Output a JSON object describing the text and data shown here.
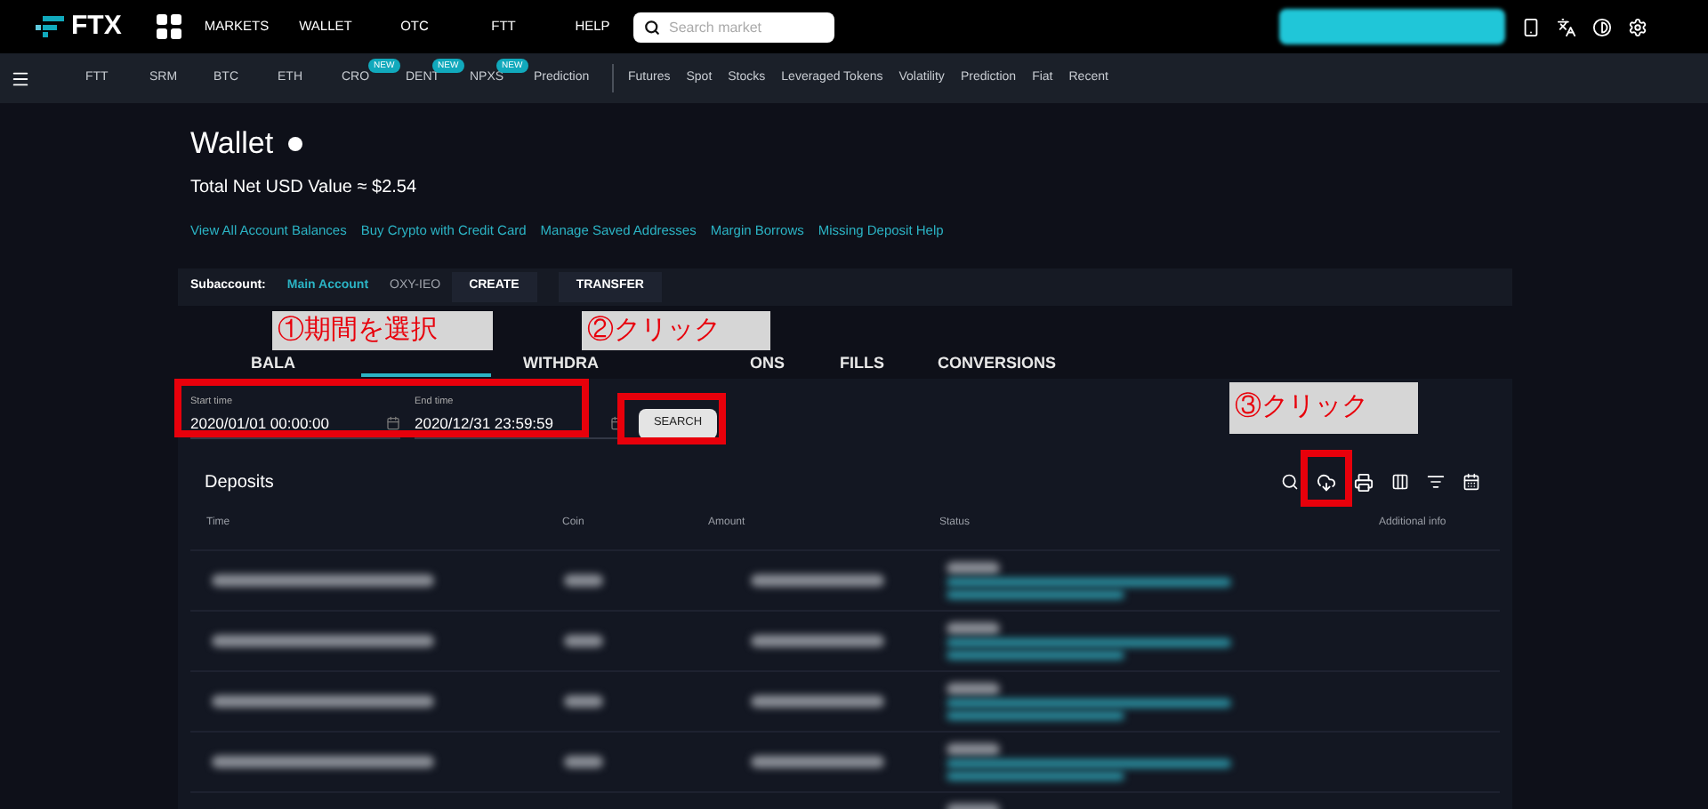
{
  "top_nav": {
    "logo": "FTX",
    "links": [
      "MARKETS",
      "WALLET",
      "OTC",
      "FTT",
      "HELP"
    ],
    "search": {
      "placeholder": "Search market"
    }
  },
  "sub_nav": {
    "groups": [
      [
        {
          "label": "FTT"
        },
        {
          "label": "SRM"
        },
        {
          "label": "BTC"
        },
        {
          "label": "ETH"
        },
        {
          "label": "CRO",
          "badge": "NEW"
        },
        {
          "label": "DENT",
          "badge": "NEW"
        },
        {
          "label": "NPXS",
          "badge": "NEW"
        },
        {
          "label": "Prediction"
        }
      ],
      [
        {
          "label": "Futures"
        },
        {
          "label": "Spot"
        },
        {
          "label": "Stocks"
        },
        {
          "label": "Leveraged Tokens"
        },
        {
          "label": "Volatility"
        },
        {
          "label": "Prediction"
        },
        {
          "label": "Fiat"
        },
        {
          "label": "Recent"
        }
      ]
    ]
  },
  "page": {
    "title": "Wallet",
    "total": "Total Net USD Value ≈ $2.54",
    "links": [
      "View All Account Balances",
      "Buy Crypto with Credit Card",
      "Manage Saved Addresses",
      "Margin Borrows",
      "Missing Deposit Help"
    ]
  },
  "subaccount": {
    "label": "Subaccount:",
    "accounts": [
      {
        "name": "Main Account",
        "selected": true
      },
      {
        "name": "OXY-IEO",
        "selected": false
      }
    ],
    "buttons": [
      "CREATE",
      "TRANSFER"
    ]
  },
  "tabs": [
    {
      "label": "BALA",
      "selected": false
    },
    {
      "selected": true
    },
    {
      "label": "WITHDRA",
      "selected": false
    },
    {
      "label": "ONS",
      "selected": false
    },
    {
      "label": "FILLS",
      "selected": false
    },
    {
      "label": "CONVERSIONS",
      "selected": false
    }
  ],
  "filters": {
    "start": {
      "label": "Start time",
      "value": "2020/01/01 00:00:00"
    },
    "end": {
      "label": "End time",
      "value": "2020/12/31 23:59:59"
    },
    "search_button": "SEARCH"
  },
  "deposits": {
    "title": "Deposits",
    "columns": [
      "Time",
      "Coin",
      "Amount",
      "Status",
      "Additional info"
    ]
  },
  "annotations": [
    "①期間を選択",
    "②クリック",
    "③クリック"
  ]
}
